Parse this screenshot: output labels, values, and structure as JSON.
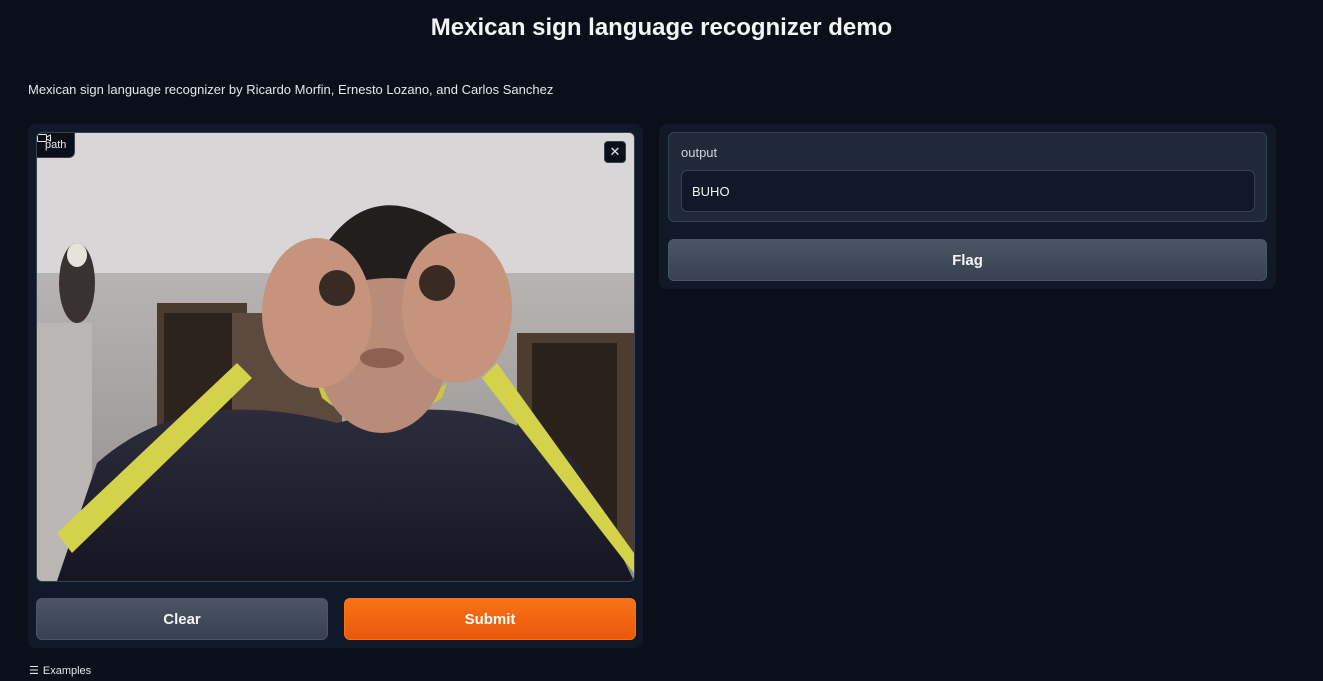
{
  "header": {
    "title": "Mexican sign language recognizer demo",
    "description": "Mexican sign language recognizer by Ricardo Morfin, Ernesto Lozano, and Carlos Sanchez"
  },
  "input_panel": {
    "video_label": "path",
    "video_icon": "video-camera-icon",
    "close_icon": "close-icon",
    "close_glyph": "✕",
    "clear_label": "Clear",
    "submit_label": "Submit"
  },
  "output_panel": {
    "label": "output",
    "value": "BUHO",
    "flag_label": "Flag"
  },
  "footer": {
    "examples_icon": "list-icon",
    "examples_glyph": "☰",
    "examples_label": "Examples"
  },
  "colors": {
    "background": "#0b0f19",
    "panel": "#111827",
    "accent": "#f97316"
  }
}
